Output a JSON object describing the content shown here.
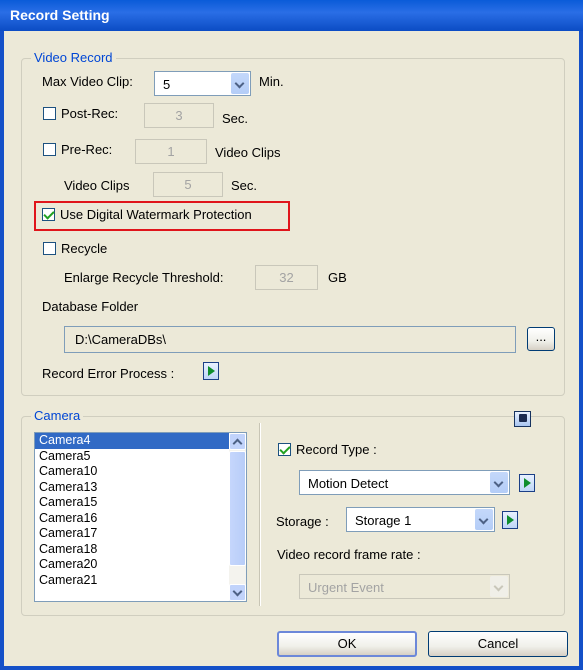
{
  "window": {
    "title": "Record Setting"
  },
  "video_record": {
    "legend": "Video Record",
    "max_clip_label": "Max Video Clip:",
    "max_clip_value": "5",
    "max_clip_unit": "Min.",
    "post_rec_label": "Post-Rec:",
    "post_rec_checked": false,
    "post_rec_value": "3",
    "post_rec_unit": "Sec.",
    "pre_rec_label": "Pre-Rec:",
    "pre_rec_checked": false,
    "pre_rec_value": "1",
    "pre_rec_unit": "Video Clips",
    "video_clips_label": "Video Clips",
    "video_clips_value": "5",
    "video_clips_unit": "Sec.",
    "watermark_label": "Use Digital Watermark Protection",
    "watermark_checked": true,
    "recycle_label": "Recycle",
    "recycle_checked": false,
    "enlarge_label": "Enlarge Recycle Threshold:",
    "enlarge_value": "32",
    "enlarge_unit": "GB",
    "db_folder_label": "Database Folder",
    "db_folder_value": "D:\\CameraDBs\\",
    "browse_label": "...",
    "error_process_label": "Record Error Process :"
  },
  "camera": {
    "legend": "Camera",
    "list": [
      "Camera4",
      "Camera5",
      "Camera10",
      "Camera13",
      "Camera15",
      "Camera16",
      "Camera17",
      "Camera18",
      "Camera20",
      "Camera21"
    ],
    "selected": "Camera4",
    "record_type_label": "Record Type :",
    "record_type_checked": true,
    "record_type_value": "Motion Detect",
    "storage_label": "Storage :",
    "storage_value": "Storage 1",
    "frame_rate_label": "Video record frame rate :",
    "frame_rate_value": "Urgent Event"
  },
  "buttons": {
    "ok": "OK",
    "cancel": "Cancel"
  },
  "colors": {
    "title_bar": "#0A5BD8",
    "legend_text": "#0046D5",
    "highlight_border": "#E0151B",
    "selected_item": "#316AC5"
  }
}
